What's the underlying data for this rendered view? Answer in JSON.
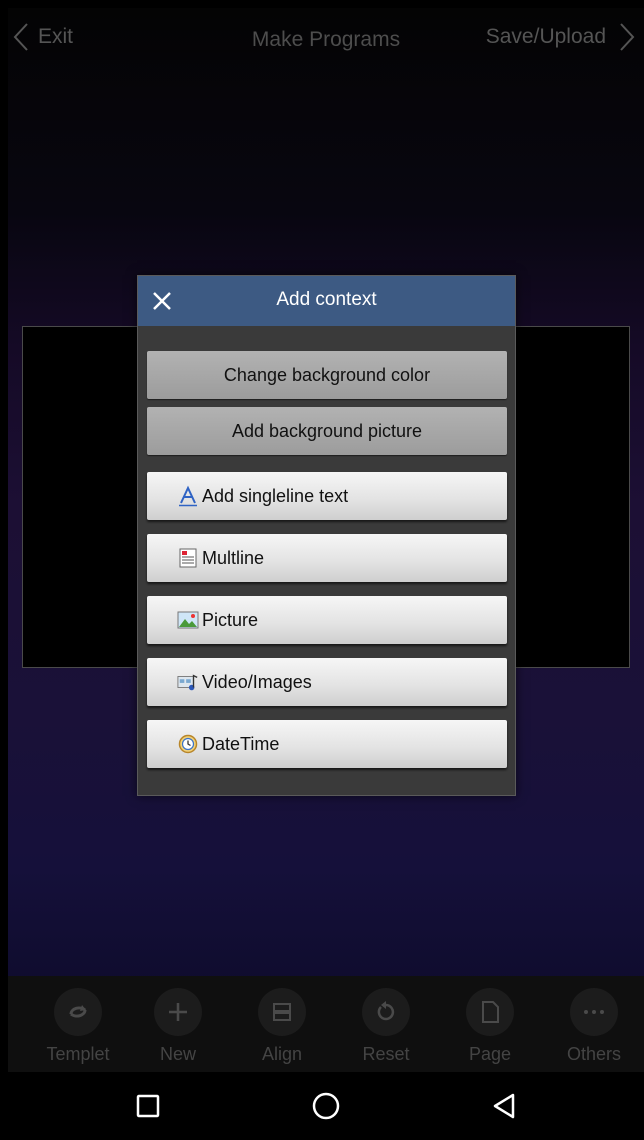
{
  "top_bar": {
    "exit_label": "Exit",
    "title": "Make Programs",
    "save_label": "Save/Upload"
  },
  "dialog": {
    "title": "Add context",
    "options": [
      {
        "label": "Change background color"
      },
      {
        "label": "Add background picture"
      },
      {
        "label": "Add singleline text",
        "icon": "text-a-icon"
      },
      {
        "label": "Multline",
        "icon": "multiline-doc-icon"
      },
      {
        "label": "Picture",
        "icon": "picture-icon"
      },
      {
        "label": "Video/Images",
        "icon": "video-images-icon"
      },
      {
        "label": "DateTime",
        "icon": "clock-icon"
      }
    ]
  },
  "toolbar": {
    "items": [
      {
        "label": "Templet",
        "icon": "templet-refresh-icon"
      },
      {
        "label": "New",
        "icon": "plus-icon"
      },
      {
        "label": "Align",
        "icon": "align-icon"
      },
      {
        "label": "Reset",
        "icon": "reset-icon"
      },
      {
        "label": "Page",
        "icon": "page-icon"
      },
      {
        "label": "Others",
        "icon": "more-icon"
      }
    ]
  },
  "system_nav": {
    "buttons": [
      "recent-apps-icon",
      "home-icon",
      "back-icon"
    ]
  },
  "colors": {
    "dialog_header": "#3d5a83",
    "dialog_body": "#3a3a3a",
    "button_gray": "#a8a8a8",
    "button_light": "#e6e6e6",
    "text_dim": "#555555"
  }
}
